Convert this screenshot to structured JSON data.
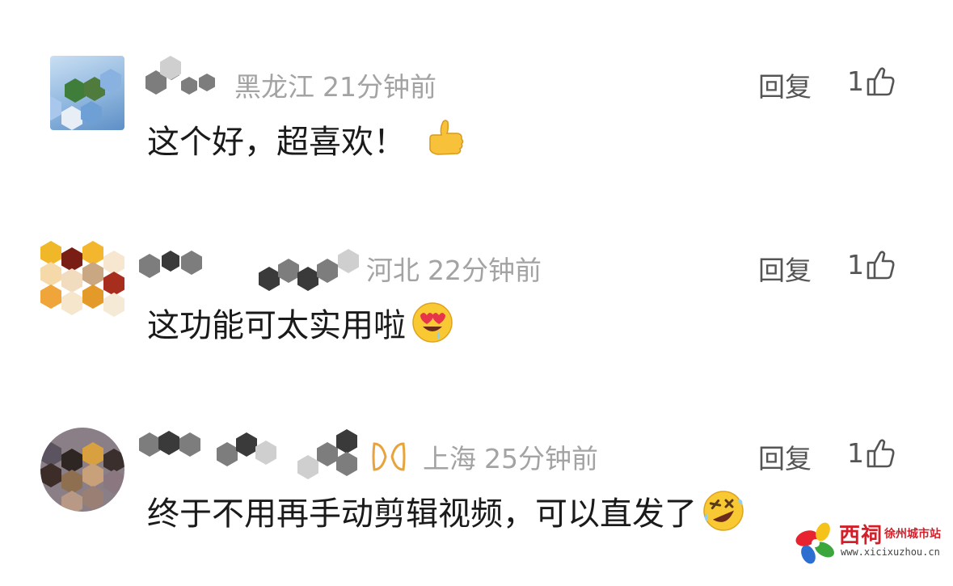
{
  "comments": [
    {
      "location": "黑龙江",
      "time": "21分钟前",
      "reply_label": "回复",
      "likes": "1",
      "text": "这个好，超喜欢！",
      "emoji": "thumbs-up-emoji"
    },
    {
      "location": "河北",
      "time": "22分钟前",
      "reply_label": "回复",
      "likes": "1",
      "text": "这功能可太实用啦",
      "emoji": "heart-eyes-drool-emoji"
    },
    {
      "location": "上海",
      "time": "25分钟前",
      "reply_label": "回复",
      "likes": "1",
      "text": "终于不用再手动剪辑视频，可以直发了",
      "emoji": "rolling-laughing-emoji"
    }
  ],
  "watermark": {
    "brand": "西祠",
    "city": "徐州城市站",
    "url": "www.xicixuzhou.cn"
  },
  "colors": {
    "meta": "#a3a3a3",
    "text": "#1a1a1a",
    "action": "#555555",
    "vip_badge": "#e8a33c",
    "brand_red": "#d21f2a"
  }
}
